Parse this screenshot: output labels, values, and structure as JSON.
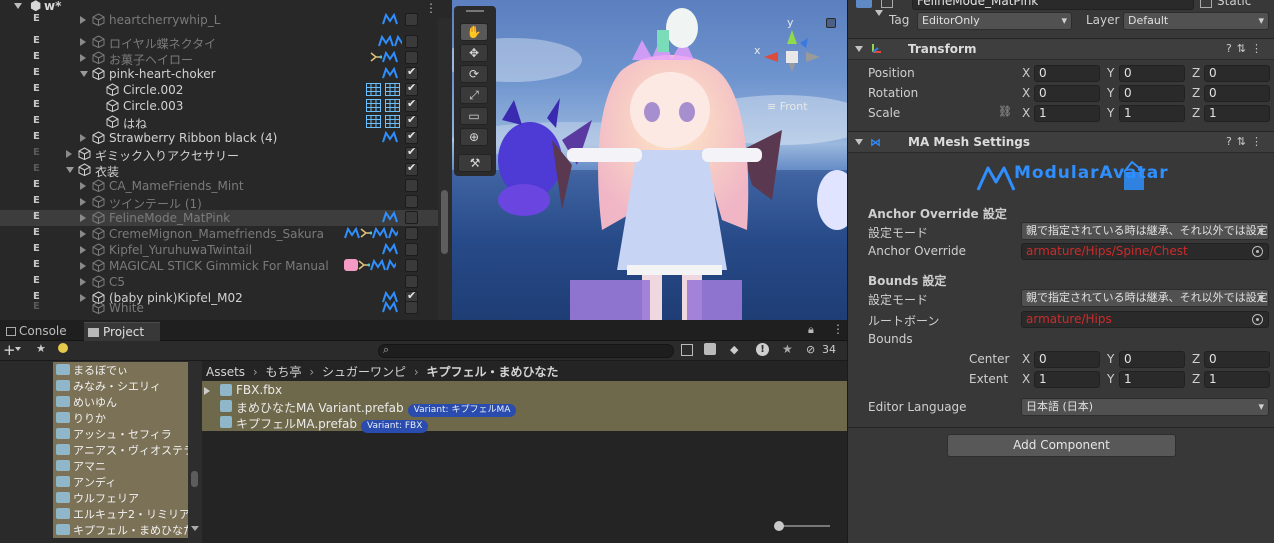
{
  "hierarchy": {
    "scene_name": "w*",
    "kebab": "⋮",
    "rows": [
      {
        "e": "E",
        "e_dim": false,
        "depth": 3,
        "arrow": "right",
        "name": "heartcherrywhip_L",
        "style": "inactive",
        "badge": "ma",
        "checked": false,
        "cut": true
      },
      {
        "e": "E",
        "e_dim": false,
        "depth": 3,
        "arrow": "right",
        "name": "ロイヤル蝶ネクタイ",
        "style": "inactive",
        "badge": "ma2",
        "checked": false
      },
      {
        "e": "E",
        "e_dim": false,
        "depth": 3,
        "arrow": "right",
        "name": "お菓子ヘイロー",
        "style": "inactive",
        "badge": "bone-ma",
        "checked": false
      },
      {
        "e": "E",
        "e_dim": false,
        "depth": 3,
        "arrow": "down",
        "name": "pink-heart-choker",
        "style": "normal",
        "badge": "ma",
        "checked": true
      },
      {
        "e": "E",
        "e_dim": false,
        "depth": 4,
        "arrow": "",
        "name": "Circle.002",
        "style": "normal",
        "badge": "grid",
        "checked": true
      },
      {
        "e": "E",
        "e_dim": false,
        "depth": 4,
        "arrow": "",
        "name": "Circle.003",
        "style": "normal",
        "badge": "grid",
        "checked": true
      },
      {
        "e": "E",
        "e_dim": false,
        "depth": 4,
        "arrow": "",
        "name": "はね",
        "style": "normal",
        "badge": "grid",
        "checked": true
      },
      {
        "e": "E",
        "e_dim": false,
        "depth": 3,
        "arrow": "right",
        "name": "Strawberry Ribbon black (4)",
        "style": "normal",
        "badge": "ma",
        "checked": true
      },
      {
        "e": "E",
        "e_dim": true,
        "depth": 2,
        "arrow": "right",
        "name": "ギミック入りアクセサリー",
        "style": "normal",
        "badge": "",
        "checked": true
      },
      {
        "e": "E",
        "e_dim": true,
        "depth": 2,
        "arrow": "down",
        "name": "衣装",
        "style": "normal",
        "badge": "",
        "checked": true
      },
      {
        "e": "E",
        "e_dim": false,
        "depth": 3,
        "arrow": "right",
        "name": "CA_MameFriends_Mint",
        "style": "inactive",
        "badge": "",
        "checked": false
      },
      {
        "e": "E",
        "e_dim": false,
        "depth": 3,
        "arrow": "right",
        "name": "ツインテール (1)",
        "style": "inactive",
        "badge": "",
        "checked": false
      },
      {
        "e": "E",
        "e_dim": false,
        "depth": 3,
        "arrow": "right",
        "name": "FelineMode_MatPink",
        "style": "inactive",
        "badge": "ma",
        "checked": false,
        "highlight": true
      },
      {
        "e": "E",
        "e_dim": false,
        "depth": 3,
        "arrow": "right",
        "name": "CremeMignon_Mamefriends_Sakura",
        "style": "inactive",
        "badge": "ma-bone-ma",
        "checked": false
      },
      {
        "e": "E",
        "e_dim": false,
        "depth": 3,
        "arrow": "right",
        "name": "Kipfel_YuruhuwaTwintail",
        "style": "inactive",
        "badge": "ma",
        "checked": false
      },
      {
        "e": "E",
        "e_dim": false,
        "depth": 3,
        "arrow": "right",
        "name": "MAGICAL STICK Gimmick For Manual",
        "style": "inactive",
        "badge": "ma-pink",
        "checked": false
      },
      {
        "e": "E",
        "e_dim": false,
        "depth": 3,
        "arrow": "right",
        "name": "C5",
        "style": "inactive",
        "badge": "",
        "checked": false
      },
      {
        "e": "E",
        "e_dim": false,
        "depth": 3,
        "arrow": "right",
        "name": "(baby pink)Kipfel_M02",
        "style": "normal",
        "badge": "ma",
        "checked": true
      },
      {
        "e": "E",
        "e_dim": true,
        "depth": 3,
        "arrow": "",
        "name": "White",
        "style": "inactive",
        "badge": "ma",
        "checked": false,
        "cut": true
      }
    ]
  },
  "scene": {
    "view_label": "≡ Front",
    "axis_y": "y",
    "axis_x": "x",
    "tools": [
      "✋",
      "✥",
      "⟳",
      "⤢",
      "▭",
      "⊕",
      "⚒"
    ]
  },
  "bottom": {
    "tabs": [
      {
        "label": "Console",
        "icon": "console-icon"
      },
      {
        "label": "Project",
        "icon": "folder-icon"
      }
    ],
    "hidden_count": "34",
    "breadcrumb": [
      "Assets",
      "もち亭",
      "シュガーワンピ",
      "キプフェル・まめひなた"
    ],
    "folders": [
      "まるぼでぃ",
      "みなみ・シエリィ",
      "めいゆん",
      "りりか",
      "アッシュ・セフィラ",
      "アニアス・ヴィオステラ",
      "アマニ",
      "アンディ",
      "ウルフェリア",
      "エルキュナ2・リミリア",
      "キプフェル・まめひなた"
    ],
    "files": [
      {
        "name": "FBX.fbx",
        "badge": "",
        "arrow": true
      },
      {
        "name": "まめひなたMA Variant.prefab",
        "badge": "Variant: キプフェルMA",
        "arrow": false
      },
      {
        "name": "キプフェルMA.prefab",
        "badge": "Variant: FBX",
        "arrow": false
      }
    ]
  },
  "inspector": {
    "object_name": "FelineMode_MatPink",
    "static_label": "Static",
    "tag_label": "Tag",
    "tag_value": "EditorOnly",
    "layer_label": "Layer",
    "layer_value": "Default",
    "transform": {
      "title": "Transform",
      "position_label": "Position",
      "rotation_label": "Rotation",
      "scale_label": "Scale",
      "position": {
        "x": "0",
        "y": "0",
        "z": "0"
      },
      "rotation": {
        "x": "0",
        "y": "0",
        "z": "0"
      },
      "scale": {
        "x": "1",
        "y": "1",
        "z": "1"
      }
    },
    "mesh_settings": {
      "title": "MA Mesh Settings",
      "logo_text": "ModularAvatar",
      "anchor_section": "Anchor Override 設定",
      "mode_label": "設定モード",
      "anchor_mode_value": "親で指定されている時は継承、それ以外では設定",
      "anchor_override_label": "Anchor Override",
      "anchor_override_value": "armature/Hips/Spine/Chest",
      "bounds_section": "Bounds 設定",
      "bounds_mode_value": "親で指定されている時は継承、それ以外では設定",
      "root_bone_label": "ルートボーン",
      "root_bone_value": "armature/Hips",
      "bounds_label": "Bounds",
      "center_label": "Center",
      "extent_label": "Extent",
      "center": {
        "x": "0",
        "y": "0",
        "z": "0"
      },
      "extent": {
        "x": "1",
        "y": "1",
        "z": "1"
      },
      "language_label": "Editor Language",
      "language_value": "日本語 (日本)"
    },
    "add_component_label": "Add Component",
    "axis_labels": {
      "x": "X",
      "y": "Y",
      "z": "Z"
    }
  },
  "colors": {
    "ma_blue": "#2f8fff",
    "reference_red": "#ce2b2b",
    "folder_bg": "#7b7156"
  }
}
